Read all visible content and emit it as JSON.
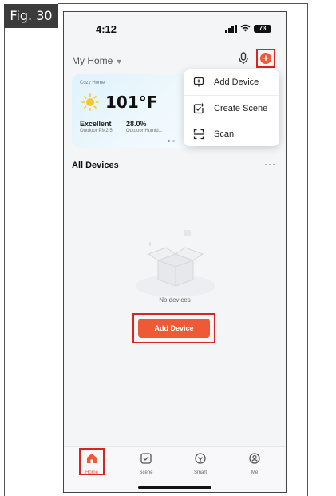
{
  "figure_label": "Fig. 30",
  "status_bar": {
    "time": "4:12",
    "battery": "73"
  },
  "header": {
    "home_name": "My Home",
    "caret": "▼"
  },
  "weather_card": {
    "home_label": "Cozy Home",
    "temperature": "101°F",
    "air_quality_value": "Excellent",
    "air_quality_label": "Outdoor PM2.5",
    "humidity_value": "28.0%",
    "humidity_label": "Outdoor Humid..."
  },
  "dropdown_menu": {
    "items": [
      {
        "label": "Add Device",
        "icon": "add-device-icon"
      },
      {
        "label": "Create Scene",
        "icon": "create-scene-icon"
      },
      {
        "label": "Scan",
        "icon": "scan-icon"
      }
    ]
  },
  "devices": {
    "section_title": "All Devices",
    "more": "···",
    "empty_text": "No devices",
    "add_button": "Add Device"
  },
  "tab_bar": {
    "tabs": [
      {
        "label": "Home",
        "icon": "home-icon",
        "active": true
      },
      {
        "label": "Scene",
        "icon": "scene-icon",
        "active": false
      },
      {
        "label": "Smart",
        "icon": "smart-icon",
        "active": false
      },
      {
        "label": "Me",
        "icon": "profile-icon",
        "active": false
      }
    ]
  },
  "colors": {
    "accent": "#ee5a36",
    "highlight_box": "#d62525"
  }
}
